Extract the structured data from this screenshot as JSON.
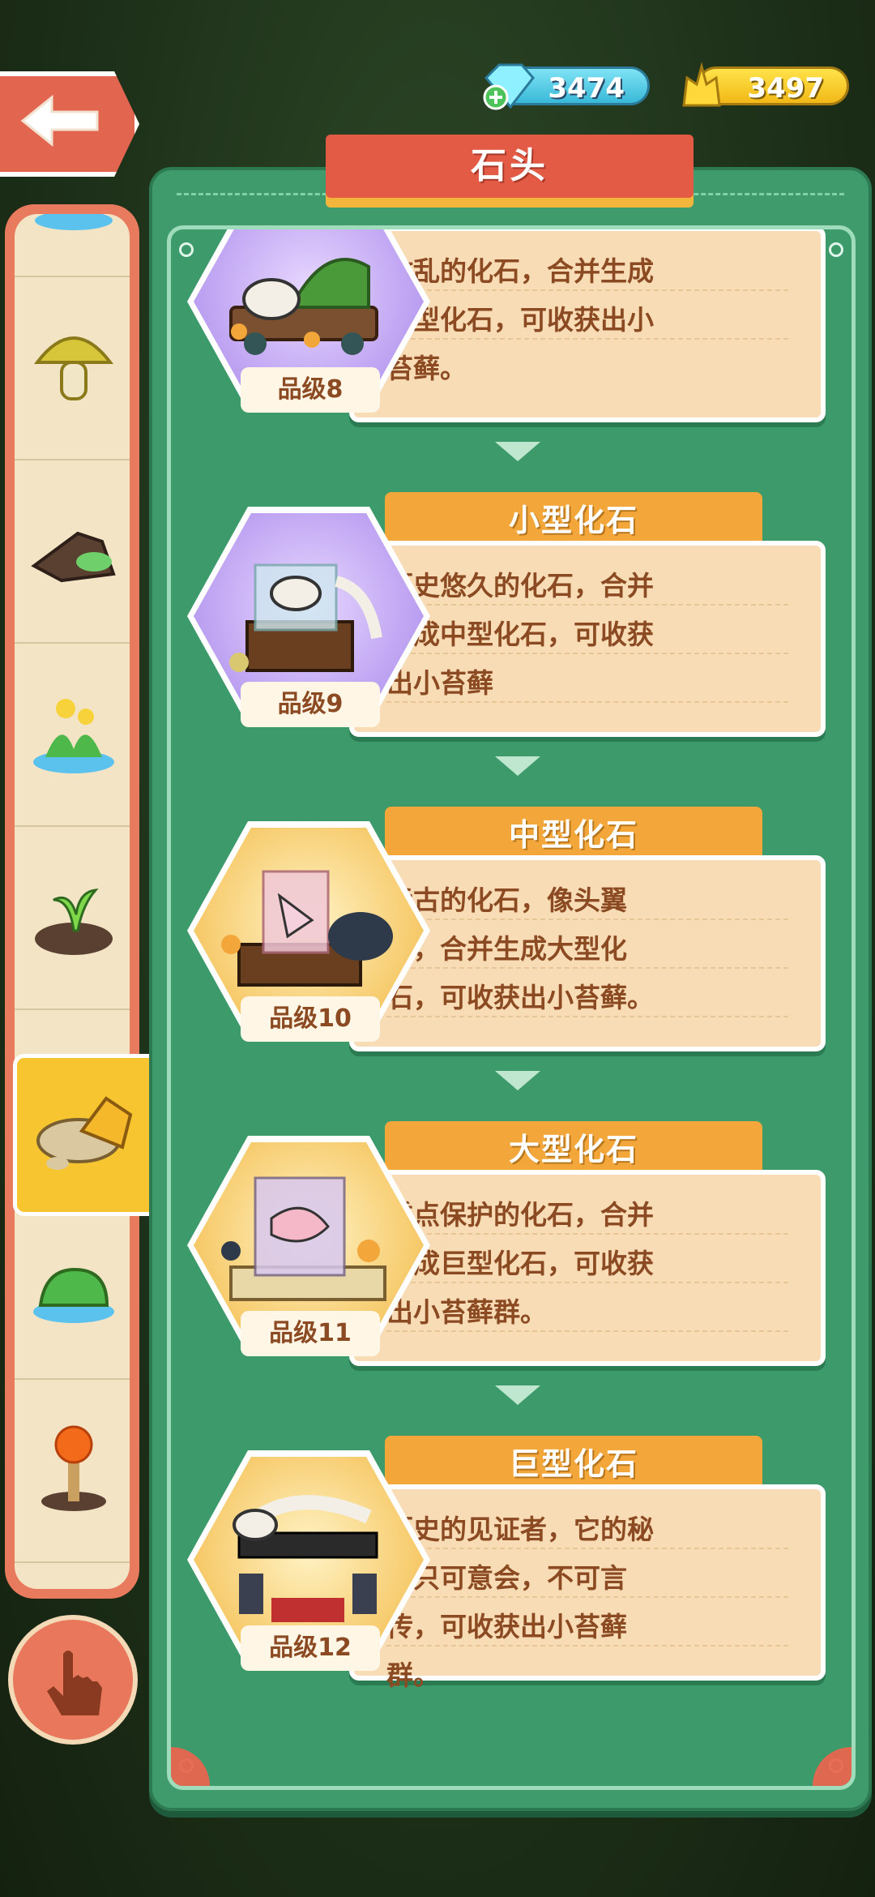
{
  "header": {
    "title": "石头",
    "gems": "3474",
    "gold": "3497"
  },
  "sidebar": {
    "items": [
      {
        "icon": "water-icon"
      },
      {
        "icon": "mushroom-icon"
      },
      {
        "icon": "mossy-log-icon"
      },
      {
        "icon": "flower-icon"
      },
      {
        "icon": "sprout-icon"
      },
      {
        "icon": "stone-leaf-icon"
      },
      {
        "icon": "moss-rock-icon"
      },
      {
        "icon": "lava-sprout-icon"
      }
    ],
    "selected_index": 5
  },
  "cards": [
    {
      "name": "",
      "desc": [
        "散乱的化石，合并生成",
        "小型化石，可收获出小",
        "苔藓。"
      ],
      "grade": "品级8",
      "style": "purple"
    },
    {
      "name": "小型化石",
      "desc": [
        "历史悠久的化石，合并",
        "生成中型化石，可收获",
        "出小苔藓"
      ],
      "grade": "品级9",
      "style": "purple"
    },
    {
      "name": "中型化石",
      "desc": [
        "远古的化石，像头翼",
        "龙，合并生成大型化",
        "石，可收获出小苔藓。"
      ],
      "grade": "品级10",
      "style": "orange"
    },
    {
      "name": "大型化石",
      "desc": [
        "重点保护的化石，合并",
        "生成巨型化石，可收获",
        "出小苔藓群。"
      ],
      "grade": "品级11",
      "style": "orange"
    },
    {
      "name": "巨型化石",
      "desc": [
        "历史的见证者，它的秘",
        "密只可意会，不可言",
        "传，可收获出小苔藓",
        "群。"
      ],
      "grade": "品级12",
      "style": "orange"
    }
  ],
  "colors": {
    "accent_red": "#e35a45",
    "panel_green": "#3f9b6c",
    "tab_orange": "#f3a73b",
    "text_brown": "#8b4a22"
  }
}
